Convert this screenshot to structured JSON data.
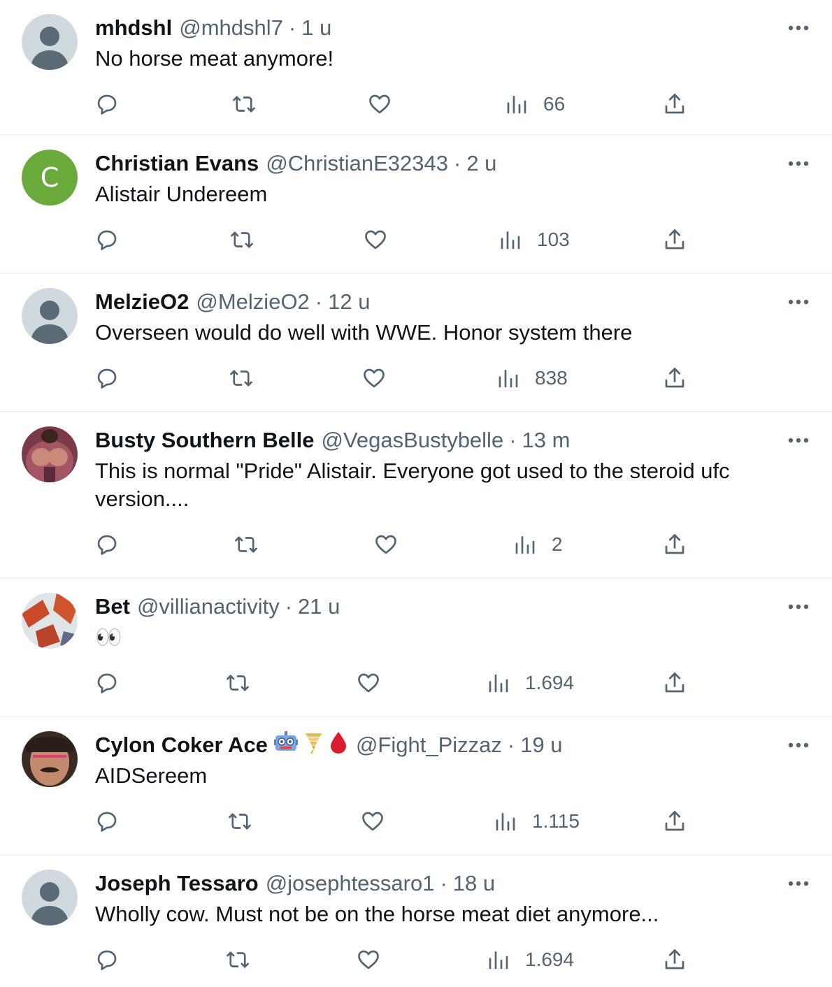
{
  "colors": {
    "text": "#0f1419",
    "secondary": "#536471",
    "divider": "#eff3f4",
    "avatar_default": "#cfd9de",
    "avatar_green": "#6aaa3b"
  },
  "tweets": [
    {
      "name": "mhdshl",
      "handle": "@mhdshl7",
      "time": "1 u",
      "text": "No horse meat anymore!",
      "views": "66",
      "avatar": "default-avatar-icon"
    },
    {
      "name": "Christian Evans",
      "handle": "@ChristianE32343",
      "time": "2 u",
      "text": "Alistair Undereem",
      "views": "103",
      "avatar": "letter-avatar",
      "avatar_letter": "C"
    },
    {
      "name": "MelzieO2",
      "handle": "@MelzieO2",
      "time": "12 u",
      "text": "Overseen would do well with WWE. Honor system there",
      "views": "838",
      "avatar": "default-avatar-icon"
    },
    {
      "name": "Busty Southern Belle",
      "handle": "@VegasBustybelle",
      "time": "13 m",
      "text": "This is normal \"Pride\" Alistair. Everyone got used to the steroid ufc version....",
      "views": "2",
      "avatar": "photo-avatar"
    },
    {
      "name": "Bet",
      "handle": "@villianactivity",
      "time": "21 u",
      "text": "👀",
      "views": "1.694",
      "avatar": "photo-avatar"
    },
    {
      "name": "Cylon Coker Ace",
      "name_emojis": [
        "robot-emoji",
        "tornado-emoji",
        "blood-drop-emoji"
      ],
      "handle": "@Fight_Pizzaz",
      "time": "19 u",
      "text": "AIDSereem",
      "views": "1.115",
      "avatar": "photo-avatar"
    },
    {
      "name": "Joseph Tessaro",
      "handle": "@josephtessaro1",
      "time": "18 u",
      "text": "Wholly cow. Must not be on the horse meat diet anymore...",
      "views": "1.694",
      "avatar": "default-avatar-icon"
    }
  ],
  "dot_separator": "·"
}
